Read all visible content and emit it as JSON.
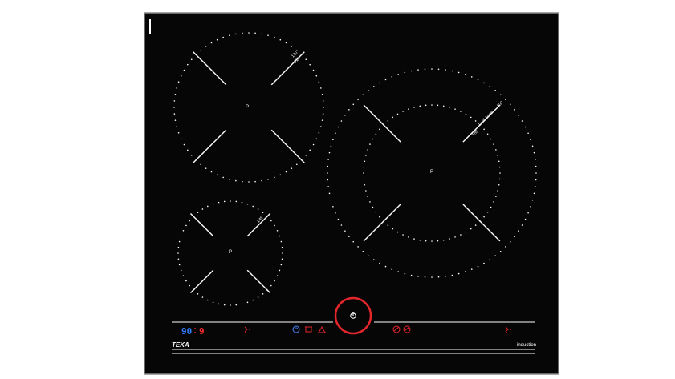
{
  "hob": {
    "brand": "TEKA",
    "tagline": "induction",
    "colors": {
      "glass": "#060606",
      "frame": "#8a8a8a",
      "markings": "#ffffff",
      "power_ring": "#e3262b",
      "timer_digits": "#ff2a2a",
      "power_digits": "#2f7cff",
      "accent_icon": "#e3262b",
      "blue_icon": "#4f86ff"
    },
    "zones": {
      "top_left": {
        "power_label": "P",
        "marks": [
          "120",
          "210"
        ]
      },
      "bottom_left": {
        "power_label": "P",
        "marks": [
          "145"
        ]
      },
      "right": {
        "power_label": "P",
        "marks": [
          "180",
          "Dual Zone",
          "300"
        ]
      }
    },
    "controls": {
      "display_power": "90",
      "display_timer": "9",
      "power_icon": "power-icon",
      "left_group_icons": [
        "slider-arrows-icon",
        "keep-warm-icon",
        "pot-icon",
        "boost-icon"
      ],
      "right_group_icons": [
        "flex-zone-icon",
        "bridge-icon",
        "slider-arrows-icon"
      ]
    }
  }
}
